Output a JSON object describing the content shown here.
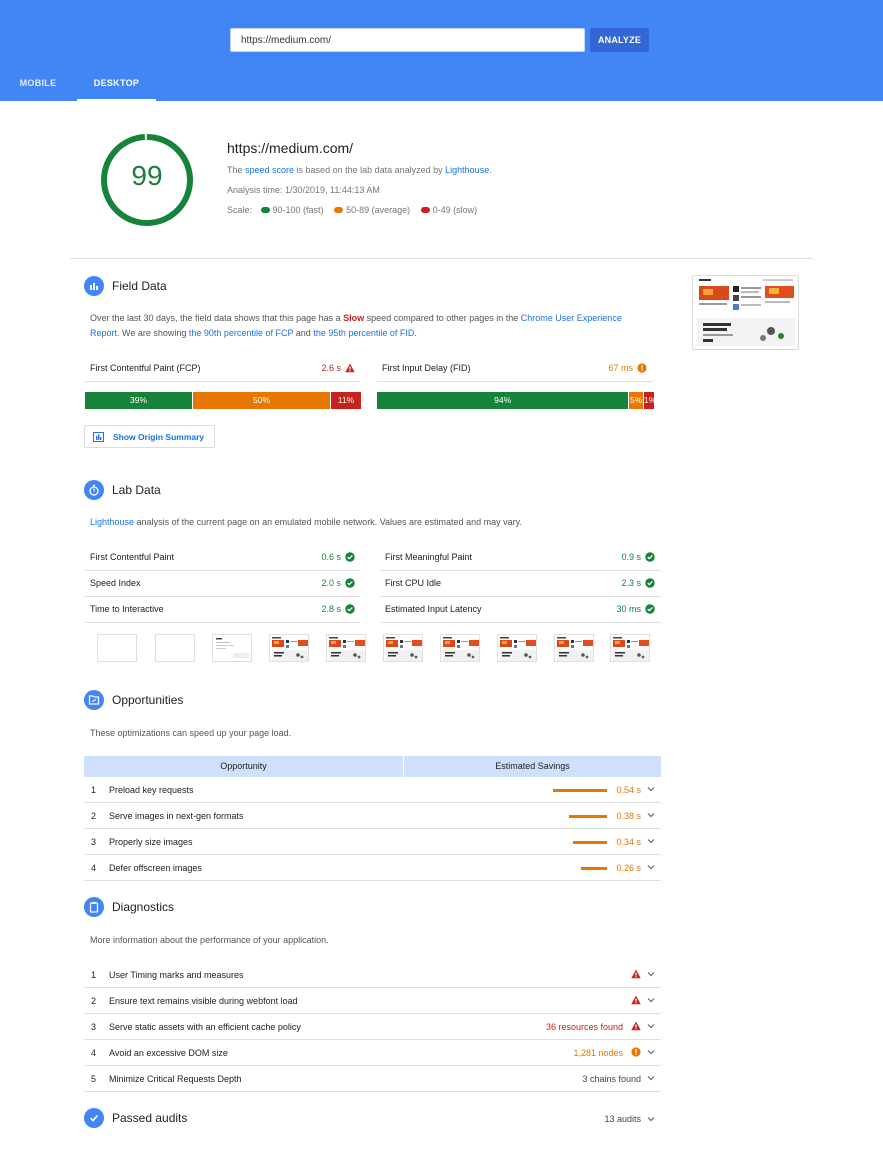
{
  "header": {
    "url_value": "https://medium.com/",
    "analyze_label": "ANALYZE",
    "tabs": [
      {
        "label": "MOBILE"
      },
      {
        "label": "DESKTOP"
      }
    ]
  },
  "summary": {
    "score": "99",
    "score_fraction": 0.99,
    "url": "https://medium.com/",
    "line1_pre": "The ",
    "line1_link1": "speed score",
    "line1_mid": " is based on the lab data analyzed by ",
    "line1_link2": "Lighthouse",
    "line1_end": ".",
    "analysis_time": "Analysis time: 1/30/2019, 11:44:13 AM",
    "scale_label": "Scale:",
    "scale": [
      {
        "label": "90-100 (fast)",
        "color": "#178239"
      },
      {
        "label": "50-89 (average)",
        "color": "#e67700"
      },
      {
        "label": "0-49 (slow)",
        "color": "#c7221f"
      }
    ]
  },
  "field": {
    "title": "Field Data",
    "desc_1": "Over the last 30 days, the field data shows that this page has a ",
    "desc_slow": "Slow",
    "desc_2": " speed compared to other pages in the ",
    "desc_link1": "Chrome User Experience",
    "desc_link1b": "Report",
    "desc_3": ". We are showing ",
    "desc_link2": "the 90th percentile of FCP",
    "desc_4": " and ",
    "desc_link3": "the 95th percentile of FID",
    "desc_5": ".",
    "fcp": {
      "label": "First Contentful Paint (FCP)",
      "value": "2.6 s",
      "bars": [
        "39%",
        "50%",
        "11%"
      ],
      "fractions": [
        0.39,
        0.5,
        0.11
      ]
    },
    "fid": {
      "label": "First Input Delay (FID)",
      "value": "67 ms",
      "bars": [
        "94%",
        "5%",
        "1%"
      ],
      "fractions": [
        0.94,
        0.05,
        0.01
      ]
    },
    "origin_button": "Show Origin Summary"
  },
  "lab": {
    "title": "Lab Data",
    "desc_link": "Lighthouse",
    "desc_rest": " analysis of the current page on an emulated mobile network. Values are estimated and may vary.",
    "metrics": [
      {
        "label": "First Contentful Paint",
        "value": "0.6 s"
      },
      {
        "label": "First Meaningful Paint",
        "value": "0.9 s"
      },
      {
        "label": "Speed Index",
        "value": "2.0 s"
      },
      {
        "label": "First CPU Idle",
        "value": "2.3 s"
      },
      {
        "label": "Time to Interactive",
        "value": "2.8 s"
      },
      {
        "label": "Estimated Input Latency",
        "value": "30 ms"
      }
    ]
  },
  "opportunities": {
    "title": "Opportunities",
    "desc": "These optimizations can speed up your page load.",
    "col_opportunity": "Opportunity",
    "col_savings": "Estimated Savings",
    "items": [
      {
        "num": "1",
        "label": "Preload key requests",
        "value": "0.54 s"
      },
      {
        "num": "2",
        "label": "Serve images in next-gen formats",
        "value": "0.38 s"
      },
      {
        "num": "3",
        "label": "Properly size images",
        "value": "0.34 s"
      },
      {
        "num": "4",
        "label": "Defer offscreen images",
        "value": "0.26 s"
      }
    ]
  },
  "diagnostics": {
    "title": "Diagnostics",
    "desc": "More information about the performance of your application.",
    "items": [
      {
        "num": "1",
        "label": "User Timing marks and measures",
        "value": ""
      },
      {
        "num": "2",
        "label": "Ensure text remains visible during webfont load",
        "value": ""
      },
      {
        "num": "3",
        "label": "Serve static assets with an efficient cache policy",
        "value": "36 resources found"
      },
      {
        "num": "4",
        "label": "Avoid an excessive DOM size",
        "value": "1,281 nodes"
      },
      {
        "num": "5",
        "label": "Minimize Critical Requests Depth",
        "value": "3 chains found"
      }
    ]
  },
  "passed": {
    "title": "Passed audits",
    "count": "13 audits"
  },
  "colors": {
    "accent": "#4285f4",
    "fast": "#178239",
    "average": "#e67700",
    "slow": "#c7221f"
  }
}
